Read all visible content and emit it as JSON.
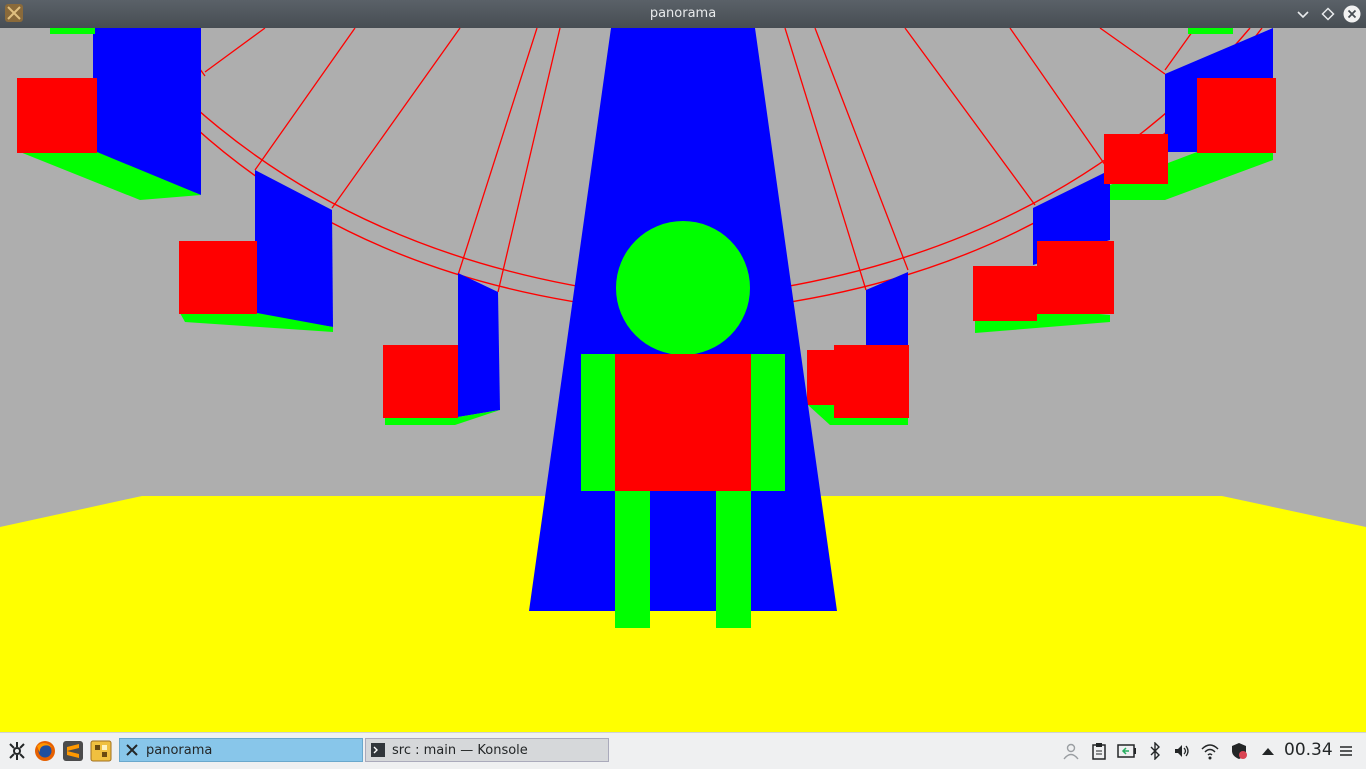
{
  "window": {
    "title": "panorama"
  },
  "taskbar": {
    "launchers": [
      "application-menu-icon",
      "firefox-icon",
      "sublime-text-icon",
      "app-launcher-icon"
    ],
    "tasks": [
      {
        "label": "panorama",
        "active": true
      },
      {
        "label": "src : main — Konsole",
        "active": false
      }
    ],
    "tray": [
      "user-icon",
      "clipboard-icon",
      "battery-icon",
      "bluetooth-icon",
      "volume-icon",
      "wifi-icon",
      "updates-shield-icon",
      "expand-tray-icon"
    ],
    "clock": "00.34"
  },
  "colors": {
    "sky": "#aeaeae",
    "floor": "#ffff00",
    "red": "#ff0000",
    "green": "#00ff00",
    "blue": "#0000ff"
  }
}
